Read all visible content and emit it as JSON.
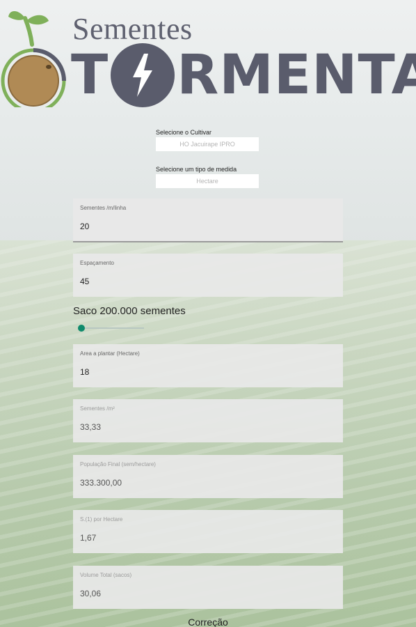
{
  "logo": {
    "top_text": "Sementes",
    "main_left": "T",
    "main_right": "RMENTA"
  },
  "cultivar": {
    "label": "Selecione o Cultivar",
    "value": "HO Jacuirape IPRO"
  },
  "medida": {
    "label": "Selecione um tipo de medida",
    "value": "Hectare"
  },
  "fields": [
    {
      "label": "Sementes /m/linha",
      "value": "20"
    },
    {
      "label": "Espaçamento",
      "value": "45"
    },
    {
      "label": "Area a plantar (Hectare)",
      "value": "18"
    },
    {
      "label": "Sementes /m²",
      "value": "33,33"
    },
    {
      "label": "População Final (sem/hectare)",
      "value": "333.300,00"
    },
    {
      "label": "S.(1) por Hectare",
      "value": "1,67"
    },
    {
      "label": "Volume Total (sacos)",
      "value": "30,06"
    }
  ],
  "saco": {
    "label": "Saco 200.000 sementes",
    "level": 0.0
  },
  "correcao_label": "Correção",
  "colors": {
    "logo": "#5a5c6c",
    "accent": "#0f8a6c",
    "seed": "#b08a55",
    "sprout": "#7fb05a"
  }
}
